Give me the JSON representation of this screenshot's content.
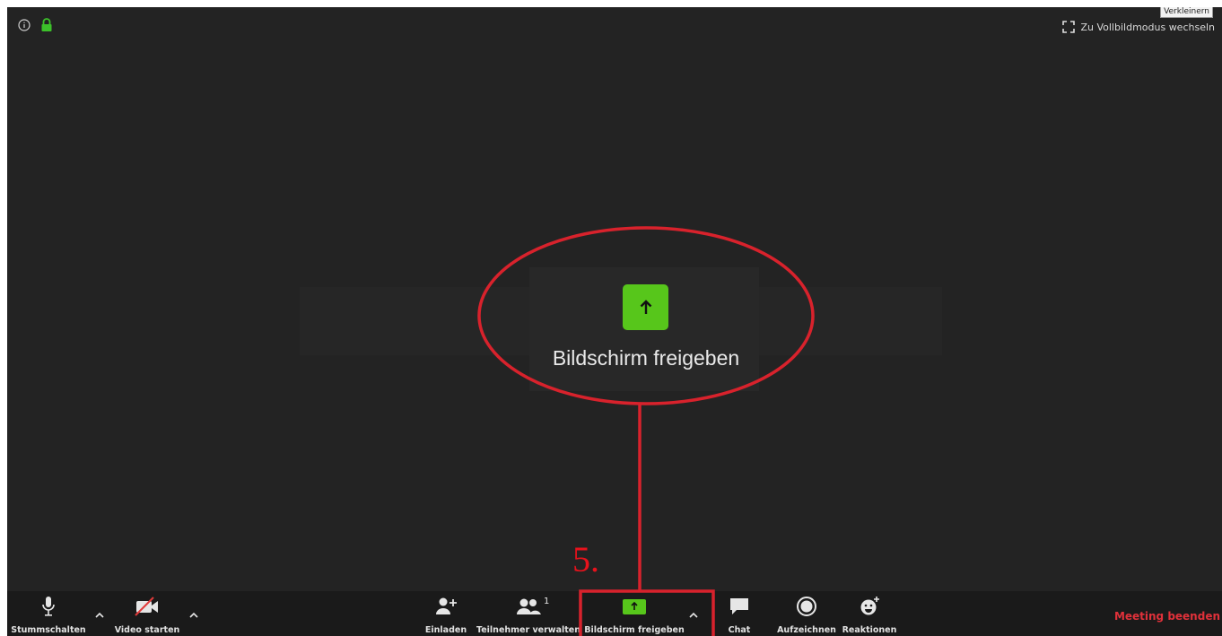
{
  "window": {
    "fullscreen_label": "Zu Vollbildmodus wechseln",
    "tooltip": "Verkleinern"
  },
  "center": {
    "share_label": "Bildschirm freigeben"
  },
  "annotation": {
    "step": "5."
  },
  "toolbar": {
    "mute_label": "Stummschalten",
    "video_label": "Video starten",
    "invite_label": "Einladen",
    "participants_label": "Teilnehmer verwalten",
    "participants_count": "1",
    "share_label": "Bildschirm freigeben",
    "chat_label": "Chat",
    "record_label": "Aufzeichnen",
    "reactions_label": "Reaktionen",
    "end_label": "Meeting beenden"
  },
  "colors": {
    "background": "#232323",
    "toolbar": "#1a1a1a",
    "share_green": "#57c61b",
    "annotation_red": "#e8121c",
    "end_red": "#e0313a"
  }
}
